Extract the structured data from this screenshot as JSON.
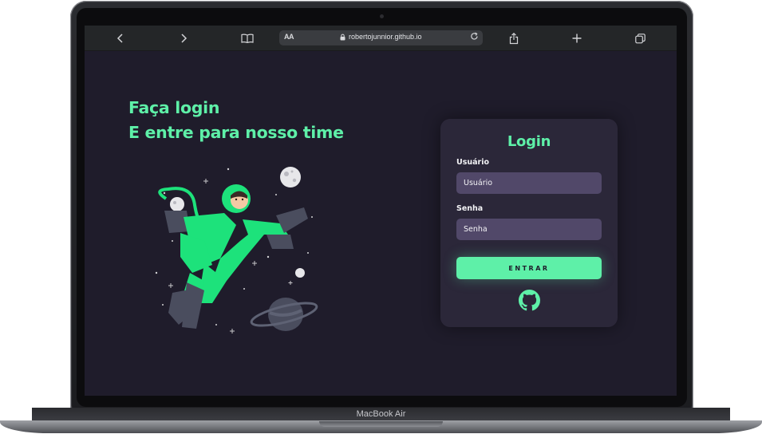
{
  "browser": {
    "text_size_label": "AA",
    "url": "robertojunnior.github.io",
    "icons": [
      "chevron-left-icon",
      "chevron-right-icon",
      "book-icon",
      "text-size-icon",
      "lock-icon",
      "reload-icon",
      "share-icon",
      "plus-icon",
      "tabs-icon"
    ]
  },
  "page": {
    "headline_line1": "Faça login",
    "headline_line2": "E entre para nosso time"
  },
  "login": {
    "title": "Login",
    "username_label": "Usuário",
    "username_placeholder": "Usuário",
    "username_value": "",
    "password_label": "Senha",
    "password_placeholder": "Senha",
    "password_value": "",
    "submit_label": "ENTRAR",
    "github_icon": "github-icon"
  },
  "device": {
    "model_label": "MacBook Air"
  },
  "colors": {
    "accent": "#5ef0a8",
    "page_background": "#1f1c2b",
    "card_background": "#2b2739",
    "input_background": "#514869"
  }
}
